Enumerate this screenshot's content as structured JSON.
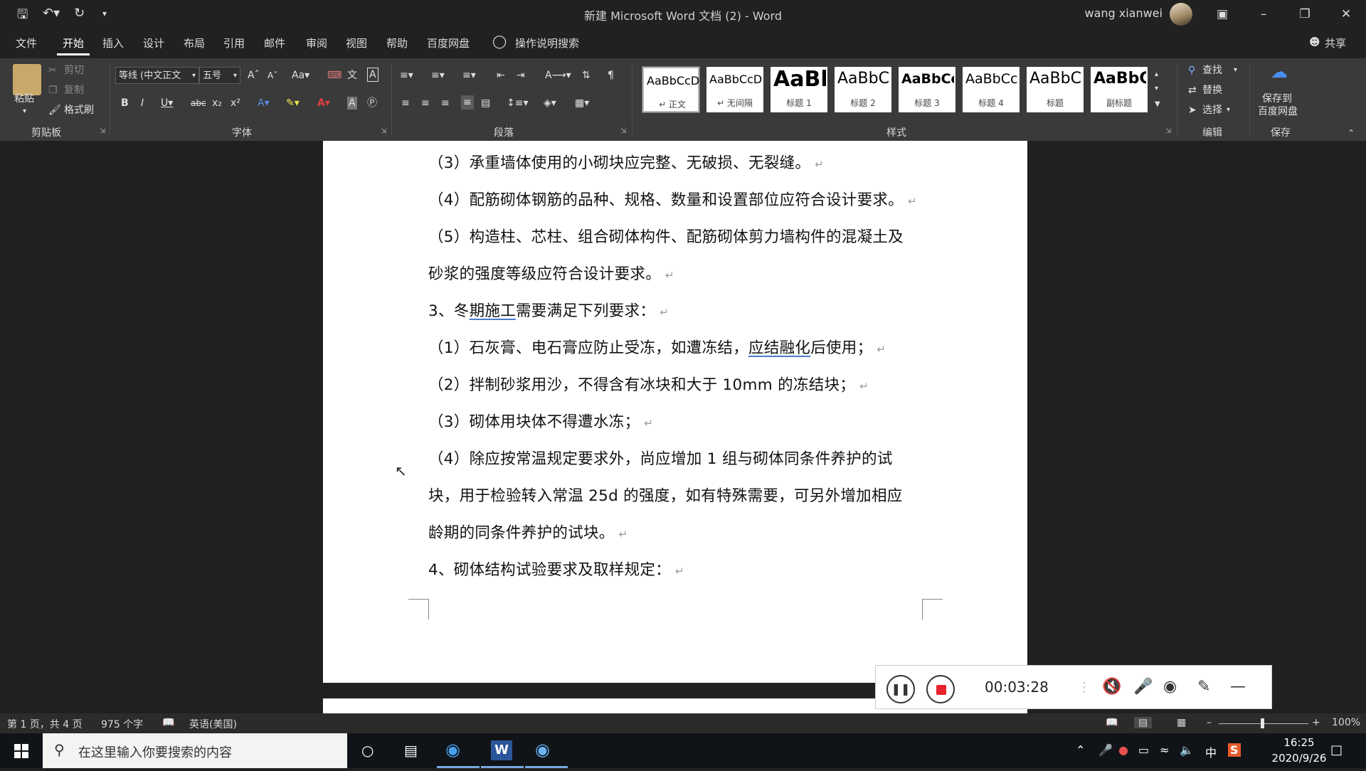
{
  "titlebar": {
    "title": "新建 Microsoft Word 文档 (2)  -  Word",
    "user": "wang xianwei"
  },
  "tabs": [
    {
      "label": "文件"
    },
    {
      "label": "开始"
    },
    {
      "label": "插入"
    },
    {
      "label": "设计"
    },
    {
      "label": "布局"
    },
    {
      "label": "引用"
    },
    {
      "label": "邮件"
    },
    {
      "label": "审阅"
    },
    {
      "label": "视图"
    },
    {
      "label": "帮助"
    },
    {
      "label": "百度网盘"
    }
  ],
  "tell_me": "操作说明搜索",
  "share": "共享",
  "clipboard": {
    "paste": "粘贴",
    "cut": "剪切",
    "copy": "复制",
    "format_painter": "格式刷",
    "label": "剪贴板"
  },
  "font": {
    "name": "等线 (中文正文",
    "size": "五号",
    "label": "字体"
  },
  "paragraph": {
    "label": "段落"
  },
  "styles": {
    "label": "样式",
    "items": [
      {
        "sample": "AaBbCcDc",
        "name": "↵ 正文"
      },
      {
        "sample": "AaBbCcDc",
        "name": "↵ 无间隔"
      },
      {
        "sample": "AaBl",
        "name": "标题 1"
      },
      {
        "sample": "AaBbC",
        "name": "标题 2"
      },
      {
        "sample": "AaBbCc",
        "name": "标题 3"
      },
      {
        "sample": "AaBbCc",
        "name": "标题 4"
      },
      {
        "sample": "AaBbC",
        "name": "标题"
      },
      {
        "sample": "AaBbC",
        "name": "副标题"
      }
    ]
  },
  "editing": {
    "find": "查找",
    "replace": "替换",
    "select": "选择",
    "label": "编辑"
  },
  "save_group": {
    "line1": "保存到",
    "line2": "百度网盘",
    "label": "保存"
  },
  "document": {
    "lines": [
      {
        "pre": "（3）承重墙体使用的小砌块应完整、无破损、无裂缝。"
      },
      {
        "pre": "（4）配筋砌体钢筋的品种、规格、数量和设置部位应符合设计要求。"
      },
      {
        "pre": "（5）构造柱、芯柱、组合砌体构件、配筋砌体剪力墙构件的混凝土及",
        "no_mark": true
      },
      {
        "pre": "砂浆的强度等级应符合设计要求。"
      },
      {
        "pre": "3、冬",
        "ul": "期施工",
        "post": "需要满足下列要求："
      },
      {
        "pre": "（1）石灰膏、电石膏应防止受冻，如遭冻结，",
        "ul": "应结融化",
        "post": "后使用；"
      },
      {
        "pre": "（2）拌制砂浆用沙，不得含有冰块和大于 10mm 的冻结块；"
      },
      {
        "pre": "（3）砌体用块体不得遭水冻；"
      },
      {
        "pre": "（4）除应按常温规定要求外，尚应增加  1  组与砌体同条件养护的试",
        "no_mark": true
      },
      {
        "pre": "块，用于检验转入常温 25d 的强度，如有特殊需要，可另外增加相应",
        "no_mark": true
      },
      {
        "pre": "龄期的同条件养护的试块。"
      },
      {
        "pre": "4、砌体结构试验要求及取样规定："
      }
    ],
    "paragraph_mark": "↵"
  },
  "recorder": {
    "time": "00:03:28"
  },
  "status": {
    "page": "第 1 页，共 4 页",
    "words": "975 个字",
    "language": "英语(美国)",
    "zoom": "100%",
    "zoom_level": 1.0
  },
  "taskbar": {
    "search_placeholder": "在这里输入你要搜索的内容",
    "ime": "中",
    "time": "16:25",
    "date": "2020/9/26"
  },
  "colors": {
    "ribbon": "#3a3a3a",
    "titlebar": "#212121",
    "document_bg": "#202020",
    "record_stop": "#e8222a",
    "word_blue": "#2b579a"
  }
}
